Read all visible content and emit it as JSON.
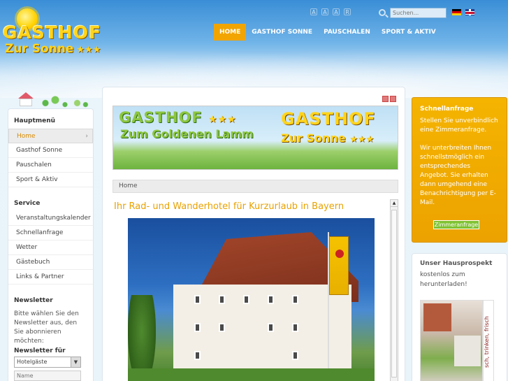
{
  "header": {
    "logo": {
      "line1": "GASTHOF",
      "line2": "Zur Sonne",
      "stars": "★★★"
    },
    "font_tools": [
      "A",
      "A",
      "A",
      "R"
    ],
    "search": {
      "placeholder": "Suchen..."
    },
    "languages": [
      "de",
      "en"
    ],
    "nav": [
      {
        "label": "HOME",
        "active": true
      },
      {
        "label": "GASTHOF SONNE",
        "active": false
      },
      {
        "label": "PAUSCHALEN",
        "active": false
      },
      {
        "label": "SPORT & AKTIV",
        "active": false
      }
    ]
  },
  "sidebar": {
    "main_menu_title": "Hauptmenü",
    "main_menu": [
      "Home",
      "Gasthof Sonne",
      "Pauschalen",
      "Sport & Aktiv"
    ],
    "service_title": "Service",
    "service": [
      "Veranstaltungskalender",
      "Schnellanfrage",
      "Wetter",
      "Gästebuch",
      "Links & Partner"
    ],
    "newsletter": {
      "title": "Newsletter",
      "text": "Bitte wählen Sie den Newsletter aus, den Sie abonnieren möchten:",
      "label": "Newsletter für",
      "select_value": "Hotelgäste",
      "name_placeholder": "Name"
    }
  },
  "main": {
    "banner": {
      "left_line1": "GASTHOF",
      "left_stars": "★★★",
      "left_line2": "Zum Goldenen Lamm",
      "right_line1": "GASTHOF",
      "right_line2": "Zur Sonne",
      "right_stars": "★★★"
    },
    "breadcrumb": "Home",
    "title": "Ihr Rad- und Wanderhotel für Kurzurlaub in Bayern"
  },
  "right": {
    "quick": {
      "title": "Schnellanfrage",
      "text1": "Stellen Sie unverbindlich eine Zimmeranfrage.",
      "text2": "Wir unterbreiten Ihnen schnellstmöglich ein entsprechendes Angebot. Sie erhalten dann umgehend eine Benachrichtigung per E-Mail.",
      "button": "Zimmeranfrage"
    },
    "prospect": {
      "title": "Unser Hausprospekt",
      "text": "kostenlos zum herunterladen!",
      "strip": "sch, trinken, frisch"
    }
  },
  "colors": {
    "accent": "#f2a400",
    "title": "#e8a200",
    "quick_bg": "#f5b400"
  }
}
